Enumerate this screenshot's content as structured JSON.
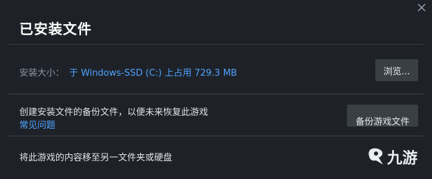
{
  "dialog": {
    "title": "已安装文件",
    "close_icon": "close-icon"
  },
  "install_size": {
    "label": "安装大小：",
    "value": "于 Windows-SSD (C:) 上占用 729.3 MB",
    "browse_button": "浏览..."
  },
  "backup": {
    "text": "创建安装文件的备份文件，以便未来恢复此游戏",
    "faq_link": "常见问题",
    "button": "备份游戏文件"
  },
  "move": {
    "text": "将此游戏的内容移至另一文件夹或硬盘"
  },
  "watermark": {
    "logo_text": "九游"
  },
  "colors": {
    "background": "#1e2228",
    "link": "#4fa3ff",
    "button_bg": "#3a3f46",
    "divider": "#3b4048"
  }
}
